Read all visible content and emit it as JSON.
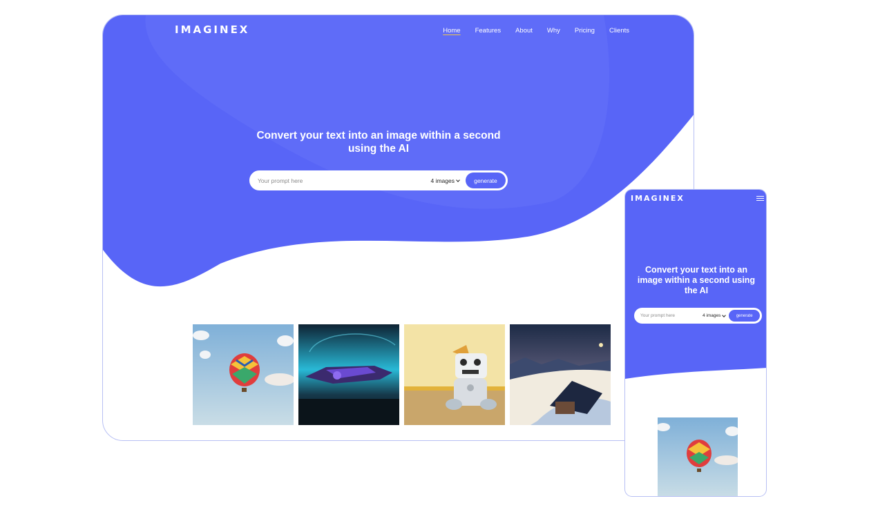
{
  "brand": "IMAGINEX",
  "nav": [
    "Home",
    "Features",
    "About",
    "Why",
    "Pricing",
    "Clients"
  ],
  "nav_active": "Home",
  "hero": {
    "title": "Convert your text into an image within a second using the AI"
  },
  "search": {
    "placeholder": "Your prompt here",
    "count": "4 images",
    "button": "generate"
  },
  "gallery": [
    {
      "subject": "hot-air-balloon"
    },
    {
      "subject": "spaceship"
    },
    {
      "subject": "plush-robot"
    },
    {
      "subject": "snowy-cabin"
    }
  ],
  "colors": {
    "accent": "#5865f7",
    "border": "#b7bff4"
  }
}
